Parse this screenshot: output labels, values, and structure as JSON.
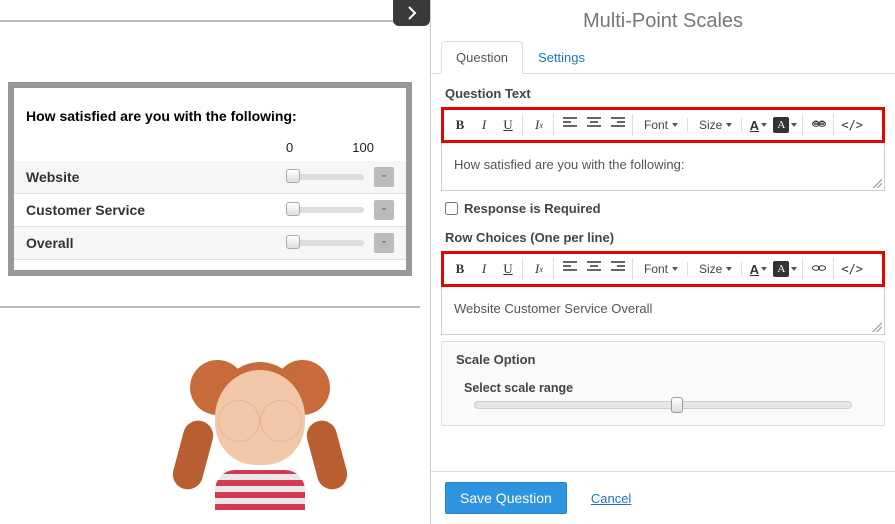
{
  "panel_title": "Multi-Point Scales",
  "tabs": {
    "question": "Question",
    "settings": "Settings"
  },
  "labels": {
    "question_text": "Question Text",
    "response_required": "Response is Required",
    "row_choices": "Row Choices (One per line)",
    "scale_option": "Scale Option",
    "select_scale_range": "Select scale range"
  },
  "question_text_value": "How satisfied are you with the following:",
  "row_choices_value": "Website Customer Service Overall",
  "response_required_checked": false,
  "toolbar": {
    "font_label": "Font",
    "size_label": "Size"
  },
  "footer": {
    "save": "Save Question",
    "cancel": "Cancel"
  },
  "preview": {
    "title": "How satisfied are you with the following:",
    "min": "0",
    "max": "100",
    "rows": [
      {
        "label": "Website"
      },
      {
        "label": "Customer Service"
      },
      {
        "label": "Overall"
      }
    ]
  }
}
